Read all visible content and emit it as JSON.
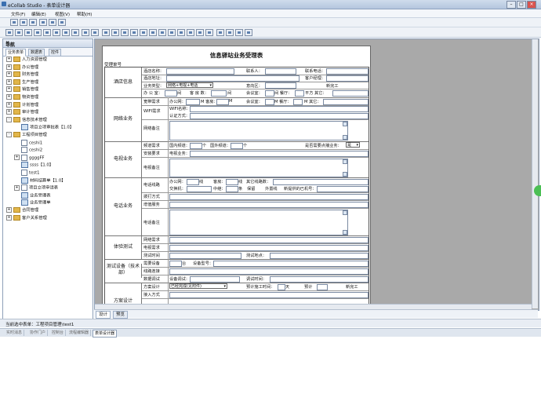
{
  "app": {
    "title": "eCollab Studio - 表单设计器"
  },
  "menu": [
    "文件(F)",
    "编辑(E)",
    "视图(V)",
    "帮助(H)"
  ],
  "nav": {
    "title": "导航",
    "close": "×",
    "tabs": [
      "业务表单",
      "数据表",
      "控件"
    ],
    "tree": [
      {
        "label": "人力资源管理",
        "level": 0,
        "type": "folder",
        "exp": "+"
      },
      {
        "label": "办公管理",
        "level": 0,
        "type": "folder",
        "exp": "+"
      },
      {
        "label": "财务管理",
        "level": 0,
        "type": "folder",
        "exp": "+"
      },
      {
        "label": "生产管理",
        "level": 0,
        "type": "folder",
        "exp": "+"
      },
      {
        "label": "销售管理",
        "level": 0,
        "type": "folder",
        "exp": "+"
      },
      {
        "label": "物资管理",
        "level": 0,
        "type": "folder",
        "exp": "+"
      },
      {
        "label": "计划管理",
        "level": 0,
        "type": "folder",
        "exp": "+"
      },
      {
        "label": "审计管理",
        "level": 0,
        "type": "folder",
        "exp": "+"
      },
      {
        "label": "信息技术管理",
        "level": 0,
        "type": "folder",
        "exp": "-"
      },
      {
        "label": "项目立项审批表【1.0】",
        "level": 1,
        "type": "grid",
        "exp": ""
      },
      {
        "label": "工程项目管理",
        "level": 0,
        "type": "folder",
        "exp": "-"
      },
      {
        "label": "ceshi1",
        "level": 1,
        "type": "doc",
        "exp": ""
      },
      {
        "label": "ceshi2",
        "level": 1,
        "type": "doc",
        "exp": ""
      },
      {
        "label": "ggggFF",
        "level": 1,
        "type": "doc",
        "exp": "+"
      },
      {
        "label": "ssss【1.0】",
        "level": 1,
        "type": "grid",
        "exp": ""
      },
      {
        "label": "test1",
        "level": 1,
        "type": "doc",
        "exp": ""
      },
      {
        "label": "材料结算单【1.0】",
        "level": 1,
        "type": "grid",
        "exp": ""
      },
      {
        "label": "项目立项申请表",
        "level": 1,
        "type": "doc",
        "exp": "+"
      },
      {
        "label": "业务受理表",
        "level": 1,
        "type": "grid",
        "exp": ""
      },
      {
        "label": "业务受理单",
        "level": 1,
        "type": "grid",
        "exp": ""
      },
      {
        "label": "合同管理",
        "level": 0,
        "type": "folder",
        "exp": "+"
      },
      {
        "label": "客户关系管理",
        "level": 0,
        "type": "folder",
        "exp": "+"
      }
    ]
  },
  "form": {
    "title": "信息驿站业务受理表",
    "number_label": "受理单号",
    "hotel": {
      "label": "酒店信息",
      "name": "酒店名称：",
      "contact": "联系人：",
      "phone": "联系电话：",
      "address": "酒店地址：",
      "manager": "客户经理：",
      "btype": "业务类型：",
      "btype_value": "网络+电视+电话",
      "region": "意向区：",
      "newhotel": "新完工",
      "office": "办 公 室：",
      "rooms": "间",
      "guestroom": "客 房 数：",
      "rooms2": "间",
      "meeting": "会议室：",
      "rooms3": "间 餐厅：",
      "area": "平方 其它："
    },
    "net": {
      "label": "网络业务",
      "req": "宽带需求",
      "office": "办公网：",
      "m1": "M 客房：",
      "m2": "M",
      "meeting": "会议室：",
      "m3": "M 餐厅：",
      "m4": "M 其它：",
      "wifi": "WIFI需求",
      "wifi_name": "WIFI名称：",
      "auth": "认证方式：",
      "note": "网络备注"
    },
    "tv": {
      "label": "电视业务",
      "req": "频道需求",
      "domestic": "国内频道：",
      "count1": "个",
      "intl": "国外频道：",
      "count2": "个",
      "point": "是否需要点播业务：",
      "point_value": "是",
      "install": "安装要求",
      "tvbiz": "电视业务：",
      "note": "电视备注"
    },
    "phone": {
      "label": "电话业务",
      "req": "电话线路",
      "office": "办公网：",
      "l1": "线",
      "guest": "客房：",
      "l2": "线",
      "other": "其它线路数：",
      "switch": "交换机：",
      "trunk": "中继：",
      "t1": "条",
      "keep": "保留",
      "outside": "外置线",
      "extension": "新提供的已机号：",
      "dial": "拨打方式",
      "value_added": "增值服务",
      "note": "电话备注"
    },
    "test": {
      "label": "体验测试",
      "net": "网络需求",
      "tv": "电视需求",
      "time": "测试时间",
      "place": "测试地点："
    },
    "equip": {
      "label": "测试设备（技术部）",
      "device": "需要设备",
      "count": "台",
      "model": "设备型号：",
      "link": "线路连接",
      "tuning": "数据调试",
      "debug": "设备调试：",
      "debug_time": "调试时间："
    },
    "plan": {
      "label": "方案设计",
      "design": "方案设计",
      "design_value": "已经完成(见附件)",
      "est": "预计施工时间：",
      "days": "天",
      "est2": "预计",
      "done": "新完工",
      "access": "接入方式"
    }
  },
  "bottom_tabs": [
    "设计",
    "预览"
  ],
  "status": "当前选中表单：工程项目管理\\test1",
  "panel_tabs": [
    "实时消息",
    "协作门户",
    "控制台",
    "流程编辑器",
    "表单设计器"
  ]
}
